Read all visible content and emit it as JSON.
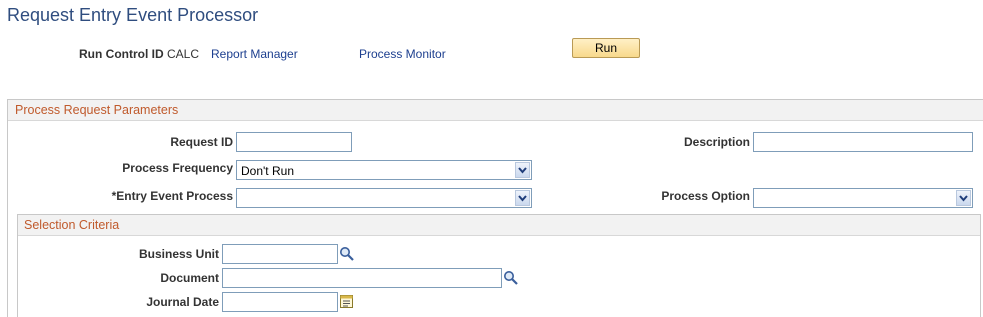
{
  "page": {
    "title": "Request Entry Event Processor"
  },
  "header": {
    "run_control_label": "Run Control ID",
    "run_control_value": "CALC",
    "report_manager_link": "Report Manager",
    "process_monitor_link": "Process Monitor",
    "run_button": "Run"
  },
  "params": {
    "section_title": "Process Request Parameters",
    "request_id_label": "Request ID",
    "request_id_value": "",
    "description_label": "Description",
    "description_value": "",
    "process_frequency_label": "Process Frequency",
    "process_frequency_value": "Don't Run",
    "entry_event_process_label": "*Entry Event Process",
    "entry_event_process_value": "",
    "process_option_label": "Process Option",
    "process_option_value": ""
  },
  "selection": {
    "section_title": "Selection Criteria",
    "business_unit_label": "Business Unit",
    "business_unit_value": "",
    "document_label": "Document",
    "document_value": "",
    "journal_date_label": "Journal Date",
    "journal_date_value": ""
  },
  "icons": {
    "lookup": "magnifier-icon",
    "calendar": "calendar-icon",
    "dropdown": "chevron-down-icon"
  }
}
